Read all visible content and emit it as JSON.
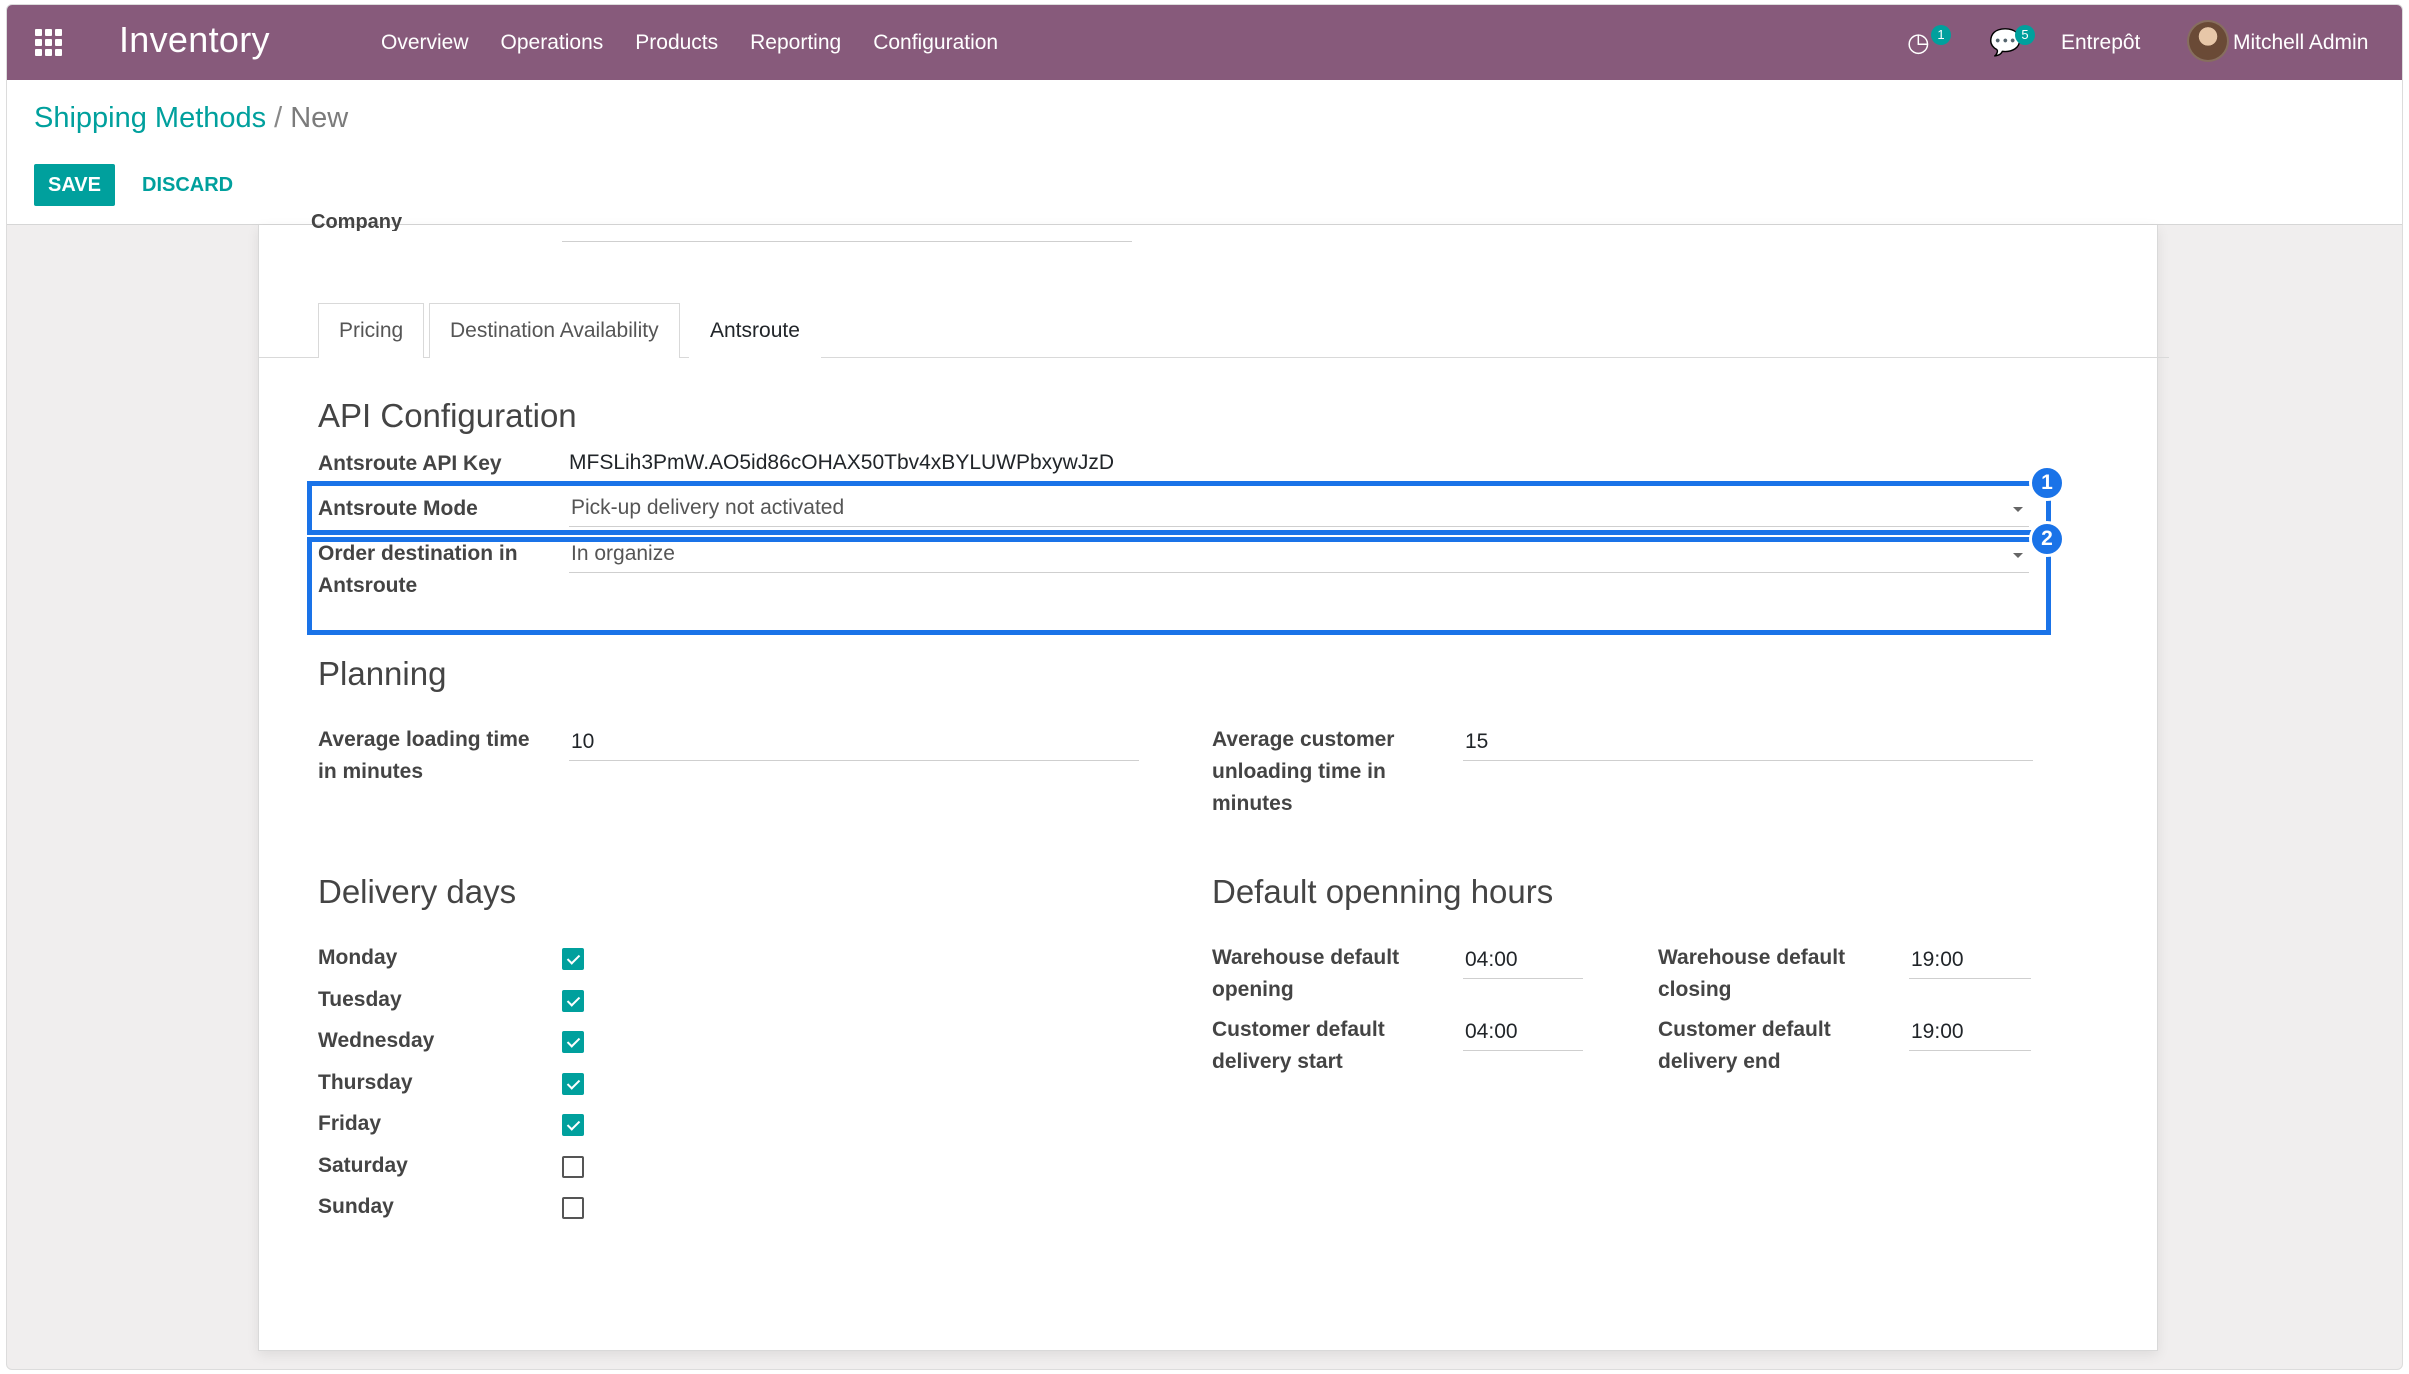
{
  "navbar": {
    "app_title": "Inventory",
    "menu": [
      "Overview",
      "Operations",
      "Products",
      "Reporting",
      "Configuration"
    ],
    "activity_count": "1",
    "messages_count": "5",
    "company": "Entrepôt",
    "user": "Mitchell Admin"
  },
  "breadcrumb": {
    "parent": "Shipping Methods",
    "separator": "/",
    "current": "New"
  },
  "buttons": {
    "save": "SAVE",
    "discard": "DISCARD"
  },
  "form": {
    "clipped_label": "Company",
    "tabs": [
      "Pricing",
      "Destination Availability",
      "Antsroute"
    ],
    "api_section": "API Configuration",
    "api_key_label": "Antsroute API Key",
    "api_key_value": "MFSLih3PmW.AO5id86cOHAX50Tbv4xBYLUWPbxywJzD",
    "mode_label": "Antsroute Mode",
    "mode_value": "Pick-up delivery not activated",
    "order_dest_label": "Order destination in Antsroute",
    "order_dest_value": "In organize",
    "planning_section": "Planning",
    "loading_label": "Average loading time in minutes",
    "loading_value": "10",
    "unloading_label": "Average customer unloading time in minutes",
    "unloading_value": "15",
    "delivery_section": "Delivery days",
    "days": [
      {
        "label": "Monday",
        "checked": true
      },
      {
        "label": "Tuesday",
        "checked": true
      },
      {
        "label": "Wednesday",
        "checked": true
      },
      {
        "label": "Thursday",
        "checked": true
      },
      {
        "label": "Friday",
        "checked": true
      },
      {
        "label": "Saturday",
        "checked": false
      },
      {
        "label": "Sunday",
        "checked": false
      }
    ],
    "hours_section": "Default openning hours",
    "wh_open_label": "Warehouse default opening",
    "wh_open_value": "04:00",
    "wh_close_label": "Warehouse default closing",
    "wh_close_value": "19:00",
    "cust_start_label": "Customer default delivery start",
    "cust_start_value": "04:00",
    "cust_end_label": "Customer default delivery end",
    "cust_end_value": "19:00"
  },
  "annotations": {
    "badge_1": "1",
    "badge_2": "2"
  },
  "colors": {
    "navbar": "#875a7b",
    "accent": "#00a09d",
    "highlight": "#1a73e8"
  }
}
